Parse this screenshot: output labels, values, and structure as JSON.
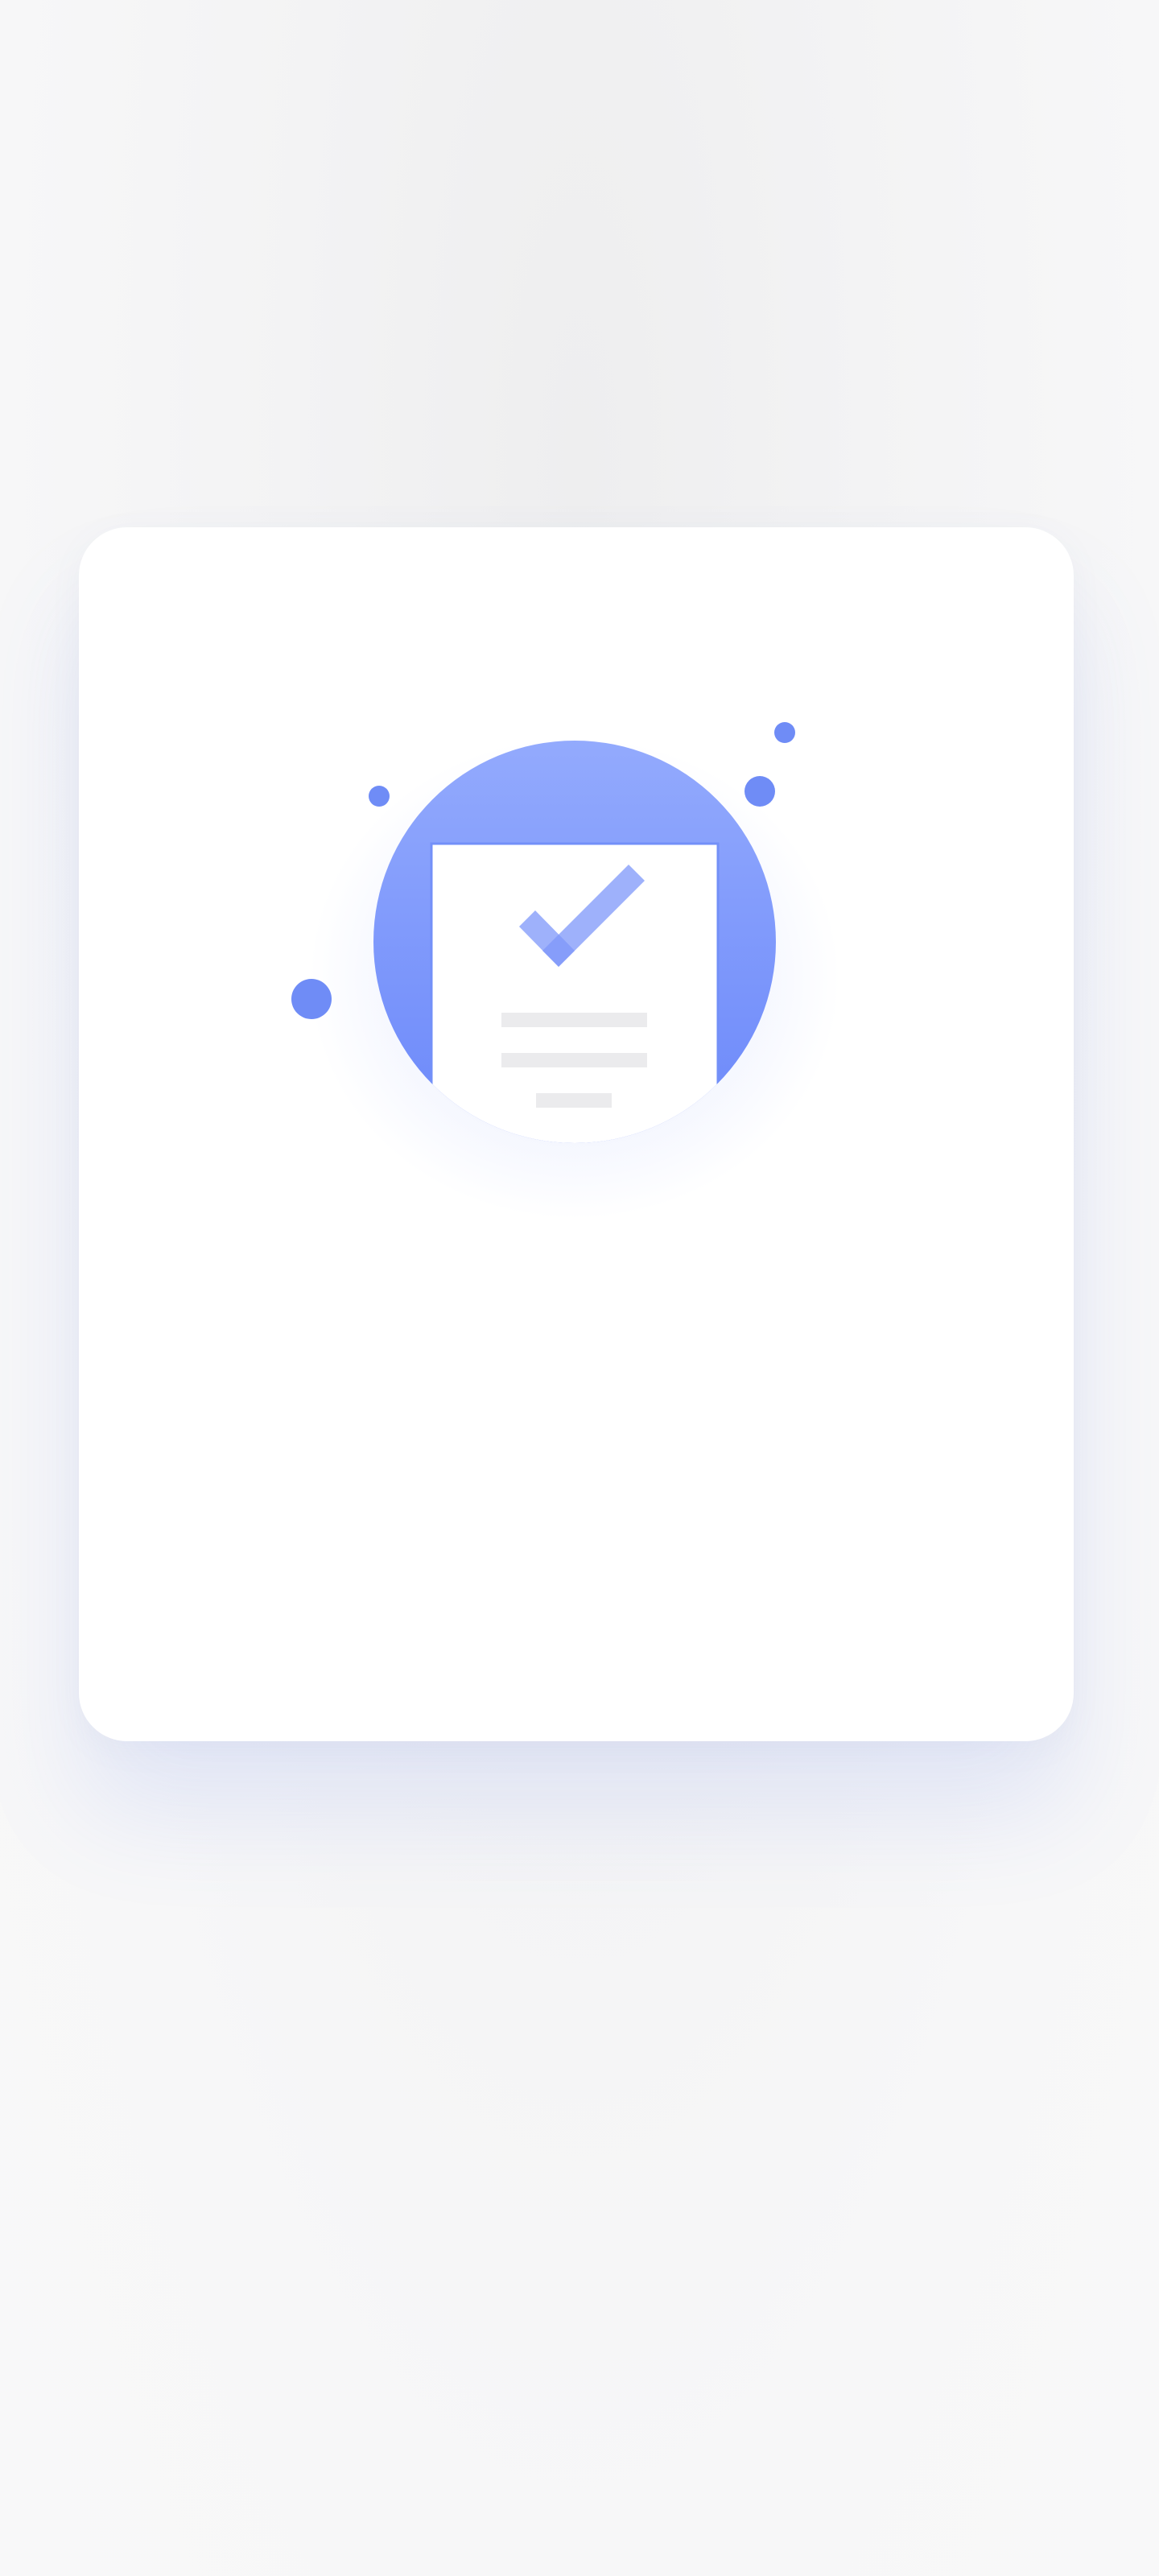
{
  "illustration": {
    "icon": "document-check-icon",
    "accent_color": "#6f8df9",
    "circle_gradient": [
      "#93aafd",
      "#6b88fa"
    ],
    "dot_color": "#5f7ff5",
    "line_color": "#ebebed"
  }
}
